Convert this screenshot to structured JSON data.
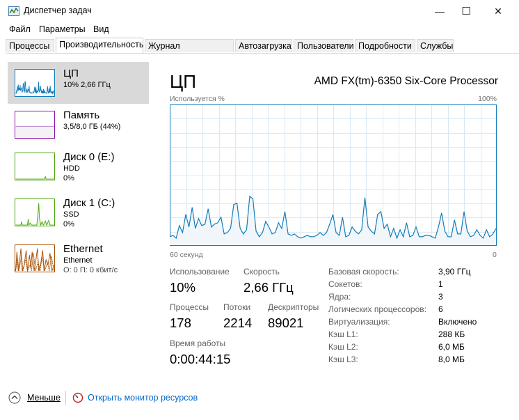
{
  "window": {
    "title": "Диспетчер задач",
    "minimize_glyph": "—",
    "maximize_glyph": "☐",
    "close_glyph": "✕"
  },
  "menu": [
    "Файл",
    "Параметры",
    "Вид"
  ],
  "tabs": [
    "Процессы",
    "Производительность",
    "Журнал приложений",
    "Автозагрузка",
    "Пользователи",
    "Подробности",
    "Службы"
  ],
  "active_tab": "Производительность",
  "sidebar": [
    {
      "name": "ЦП",
      "line1": "10% 2,66 ГГц",
      "line2": "",
      "color": "#117dbb",
      "active": true
    },
    {
      "name": "Память",
      "line1": "3,5/8,0 ГБ (44%)",
      "line2": "",
      "color": "#8b12ae",
      "active": false
    },
    {
      "name": "Диск 0 (E:)",
      "line1": "HDD",
      "line2": "0%",
      "color": "#4da60c",
      "active": false
    },
    {
      "name": "Диск 1 (C:)",
      "line1": "SSD",
      "line2": "0%",
      "color": "#4da60c",
      "active": false
    },
    {
      "name": "Ethernet",
      "line1": "Ethernet",
      "line2": "О: 0 П: 0 кбит/с",
      "color": "#a74f01",
      "active": false
    }
  ],
  "main": {
    "title": "ЦП",
    "processor": "AMD FX(tm)-6350 Six-Core Processor",
    "graph_top_left": "Используется %",
    "graph_top_right": "100%",
    "graph_bottom_left": "60 секунд",
    "graph_bottom_right": "0",
    "cpu_usage_percent": [
      6,
      7,
      5,
      14,
      9,
      22,
      13,
      27,
      12,
      19,
      14,
      15,
      26,
      13,
      15,
      16,
      20,
      8,
      9,
      12,
      29,
      30,
      12,
      8,
      11,
      35,
      33,
      10,
      6,
      9,
      17,
      13,
      8,
      9,
      16,
      12,
      24,
      8,
      7,
      8,
      6,
      5,
      6,
      7,
      6,
      6,
      7,
      9,
      7,
      9,
      15,
      22,
      9,
      7,
      20,
      6,
      7,
      13,
      10,
      8,
      11,
      34,
      13,
      10,
      8,
      22,
      24,
      12,
      15,
      6,
      12,
      5,
      11,
      6,
      16,
      6,
      7,
      13,
      6,
      6,
      7,
      7,
      6,
      5,
      13,
      23,
      10,
      6,
      6,
      18,
      8,
      8,
      24,
      10,
      6,
      7,
      11,
      7,
      5,
      11,
      6,
      8,
      12
    ]
  },
  "stats": [
    {
      "label": "Использование",
      "value": "10%"
    },
    {
      "label": "Скорость",
      "value": "2,66 ГГц"
    },
    {
      "label": "Процессы",
      "value": "178"
    },
    {
      "label": "Потоки",
      "value": "2214"
    },
    {
      "label": "Дескрипторы",
      "value": "89021"
    },
    {
      "label": "Время работы",
      "value": "0:00:44:15"
    }
  ],
  "info": [
    {
      "key": "Базовая скорость:",
      "value": "3,90 ГГц"
    },
    {
      "key": "Сокетов:",
      "value": "1"
    },
    {
      "key": "Ядра:",
      "value": "3"
    },
    {
      "key": "Логических процессоров:",
      "value": "6"
    },
    {
      "key": "Виртуализация:",
      "value": "Включено"
    },
    {
      "key": "Кэш L1:",
      "value": "288 КБ"
    },
    {
      "key": "Кэш L2:",
      "value": "6,0 МБ"
    },
    {
      "key": "Кэш L3:",
      "value": "8,0 МБ"
    }
  ],
  "footer": {
    "fewer_label": "Меньше",
    "resmon_label": "Открыть монитор ресурсов"
  },
  "colors": {
    "cpu_line": "#117dbb",
    "cpu_fill": "#f1f6fa",
    "grid": "#d9eaf4",
    "link": "#0066cc"
  }
}
